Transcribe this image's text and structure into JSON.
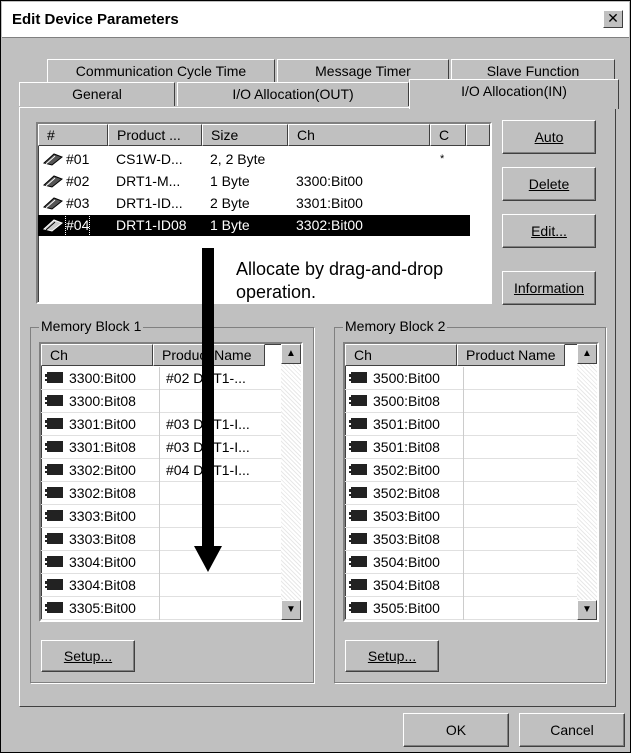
{
  "window": {
    "title": "Edit Device Parameters",
    "close_glyph": "✕"
  },
  "tabs": {
    "back_row": [
      "Communication Cycle Time",
      "Message Timer",
      "Slave Function"
    ],
    "front_row": [
      "General",
      "I/O Allocation(OUT)",
      "I/O Allocation(IN)"
    ],
    "active": "I/O Allocation(IN)"
  },
  "device_list": {
    "headers": [
      "#",
      "Product ...",
      "Size",
      "Ch",
      "C"
    ],
    "rows": [
      {
        "num": "#01",
        "product": "CS1W-D...",
        "size": "2, 2 Byte",
        "ch": "",
        "c": "*"
      },
      {
        "num": "#02",
        "product": "DRT1-M...",
        "size": "1 Byte",
        "ch": "3300:Bit00",
        "c": ""
      },
      {
        "num": "#03",
        "product": "DRT1-ID...",
        "size": "2 Byte",
        "ch": "3301:Bit00",
        "c": ""
      },
      {
        "num": "#04",
        "product": "DRT1-ID08",
        "size": "1 Byte",
        "ch": "3302:Bit00",
        "c": ""
      }
    ],
    "selected_row": "#04"
  },
  "annotation": {
    "line1": "Allocate by drag-and-drop",
    "line2": "operation."
  },
  "buttons": {
    "auto": "Auto",
    "delete": "Delete",
    "edit": "Edit...",
    "information": "Information",
    "setup": "Setup...",
    "ok": "OK",
    "cancel": "Cancel"
  },
  "memory_block_1": {
    "label": "Memory Block 1",
    "headers": [
      "Ch",
      "Product Name"
    ],
    "rows": [
      {
        "ch": "3300:Bit00",
        "product": "#02 DRT1-..."
      },
      {
        "ch": "3300:Bit08",
        "product": ""
      },
      {
        "ch": "3301:Bit00",
        "product": "#03 DRT1-I..."
      },
      {
        "ch": "3301:Bit08",
        "product": "#03 DRT1-I..."
      },
      {
        "ch": "3302:Bit00",
        "product": "#04 DRT1-I..."
      },
      {
        "ch": "3302:Bit08",
        "product": ""
      },
      {
        "ch": "3303:Bit00",
        "product": ""
      },
      {
        "ch": "3303:Bit08",
        "product": ""
      },
      {
        "ch": "3304:Bit00",
        "product": ""
      },
      {
        "ch": "3304:Bit08",
        "product": ""
      },
      {
        "ch": "3305:Bit00",
        "product": ""
      }
    ]
  },
  "memory_block_2": {
    "label": "Memory Block 2",
    "headers": [
      "Ch",
      "Product Name"
    ],
    "rows": [
      {
        "ch": "3500:Bit00",
        "product": ""
      },
      {
        "ch": "3500:Bit08",
        "product": ""
      },
      {
        "ch": "3501:Bit00",
        "product": ""
      },
      {
        "ch": "3501:Bit08",
        "product": ""
      },
      {
        "ch": "3502:Bit00",
        "product": ""
      },
      {
        "ch": "3502:Bit08",
        "product": ""
      },
      {
        "ch": "3503:Bit00",
        "product": ""
      },
      {
        "ch": "3503:Bit08",
        "product": ""
      },
      {
        "ch": "3504:Bit00",
        "product": ""
      },
      {
        "ch": "3504:Bit08",
        "product": ""
      },
      {
        "ch": "3505:Bit00",
        "product": ""
      }
    ]
  },
  "colors": {
    "selection": "#000000",
    "face": "#c0c0c0"
  }
}
